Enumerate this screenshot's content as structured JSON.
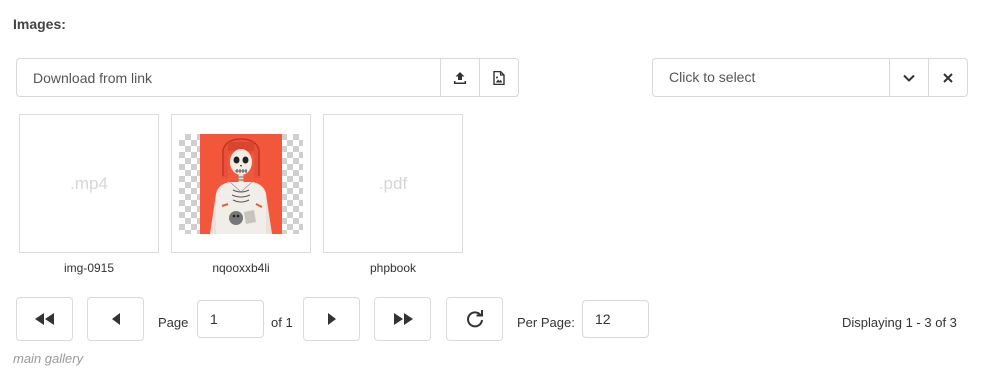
{
  "section": {
    "label": "Images:"
  },
  "link_input": {
    "placeholder": "Download from link",
    "value": ""
  },
  "link_buttons": {
    "upload_icon": "upload-icon",
    "file_icon": "file-image-icon"
  },
  "select": {
    "placeholder": "Click to select",
    "chevron_icon": "chevron-down-icon",
    "clear_icon": "close-icon"
  },
  "gallery": {
    "items": [
      {
        "name": "img-0915",
        "ext": ".mp4",
        "kind": "placeholder"
      },
      {
        "name": "nqooxxb4li",
        "ext": "",
        "kind": "image"
      },
      {
        "name": "phpbook",
        "ext": ".pdf",
        "kind": "placeholder"
      }
    ]
  },
  "pager": {
    "page_label": "Page",
    "page_value": "1",
    "of_label": "of 1",
    "per_page_label": "Per Page:",
    "per_page_value": "12",
    "display_text": "Displaying 1 - 3 of 3"
  },
  "footer": {
    "label": "main gallery"
  },
  "colors": {
    "accent_image_bg": "#f2573b",
    "border": "#d8d8d8",
    "placeholder_text": "#d6d6d6",
    "footer_text": "#999999"
  }
}
